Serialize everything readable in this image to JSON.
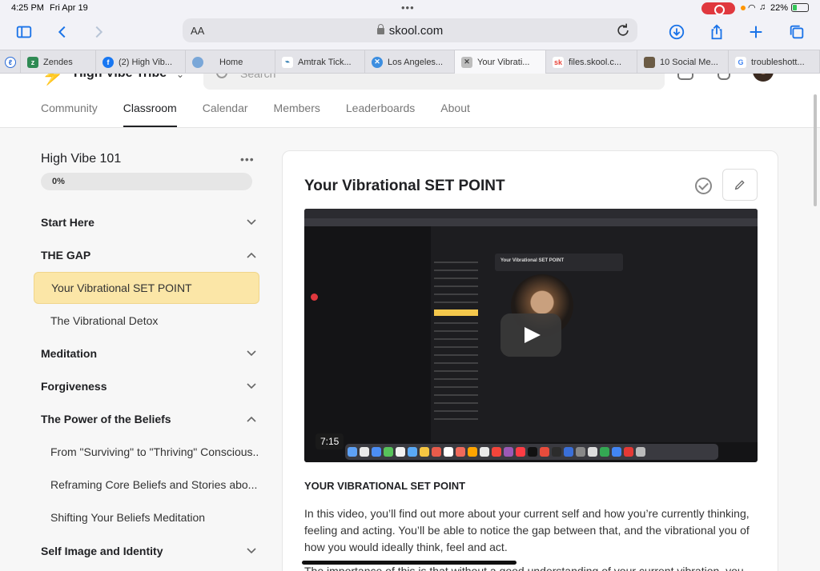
{
  "status_bar": {
    "time": "4:25 PM",
    "date": "Fri Apr 19",
    "battery": "22%"
  },
  "browser": {
    "text_size": "AA",
    "address": "skool.com"
  },
  "tabs": [
    {
      "label": "Zendes",
      "icon": "zendesk-icon",
      "color": "#2f8a54"
    },
    {
      "label": "(2) High Vib...",
      "icon": "facebook-icon",
      "color": "#1877f2"
    },
    {
      "label": "Home",
      "icon": "globe-icon",
      "color": "#7aa7d8"
    },
    {
      "label": "Amtrak Tick...",
      "icon": "amtrak-icon",
      "color": "#1a6ea8"
    },
    {
      "label": "Los Angeles...",
      "icon": "compass-icon",
      "color": "#3c8ee0"
    },
    {
      "label": "Your Vibrati...",
      "icon": "close-icon",
      "color": "#777777"
    },
    {
      "label": "files.skool.c...",
      "icon": "skool-icon",
      "color": "#e8453c"
    },
    {
      "label": "10 Social Me...",
      "icon": "social-icon",
      "color": "#6b5b45"
    },
    {
      "label": "troubleshott...",
      "icon": "google-icon",
      "color": "#4285f4"
    }
  ],
  "header": {
    "group_name": "High Vibe Tribe",
    "search_placeholder": "Search",
    "nav": [
      "Community",
      "Classroom",
      "Calendar",
      "Members",
      "Leaderboards",
      "About"
    ],
    "active_nav": "Classroom"
  },
  "course": {
    "title": "High Vibe 101",
    "progress_label": "0%",
    "progress": 0,
    "sections": [
      {
        "label": "Start Here",
        "expanded": false
      },
      {
        "label": "THE GAP",
        "expanded": true
      },
      {
        "label": "Meditation",
        "expanded": false
      },
      {
        "label": "Forgiveness",
        "expanded": false
      },
      {
        "label": "The Power of the Beliefs",
        "expanded": true
      },
      {
        "label": "Self Image and Identity",
        "expanded": false
      }
    ],
    "lessons": [
      {
        "label": "Your Vibrational SET POINT",
        "active": true
      },
      {
        "label": "The Vibrational Detox",
        "active": false
      },
      {
        "label": "From \"Surviving\" to \"Thriving\" Conscious...",
        "active": false
      },
      {
        "label": "Reframing Core Beliefs and Stories abo...",
        "active": false
      },
      {
        "label": "Shifting Your Beliefs Meditation",
        "active": false
      }
    ]
  },
  "lesson": {
    "title": "Your Vibrational SET POINT",
    "video_duration": "7:15",
    "section_heading": "YOUR VIBRATIONAL SET POINT",
    "description": "In this video, you’ll find out more about your current self and how you’re currently thinking, feeling and acting. You’ll be able to notice the gap between that, and the vibrational you of how you would ideally think, feel and act.",
    "description_cont": "The importance of this is that without a good understanding of your current vibration, you tend to set"
  },
  "colors": {
    "accent_active_lesson": "#fbe6a7",
    "progress_track": "#e6e6e6",
    "link_blue": "#1a73e8"
  }
}
